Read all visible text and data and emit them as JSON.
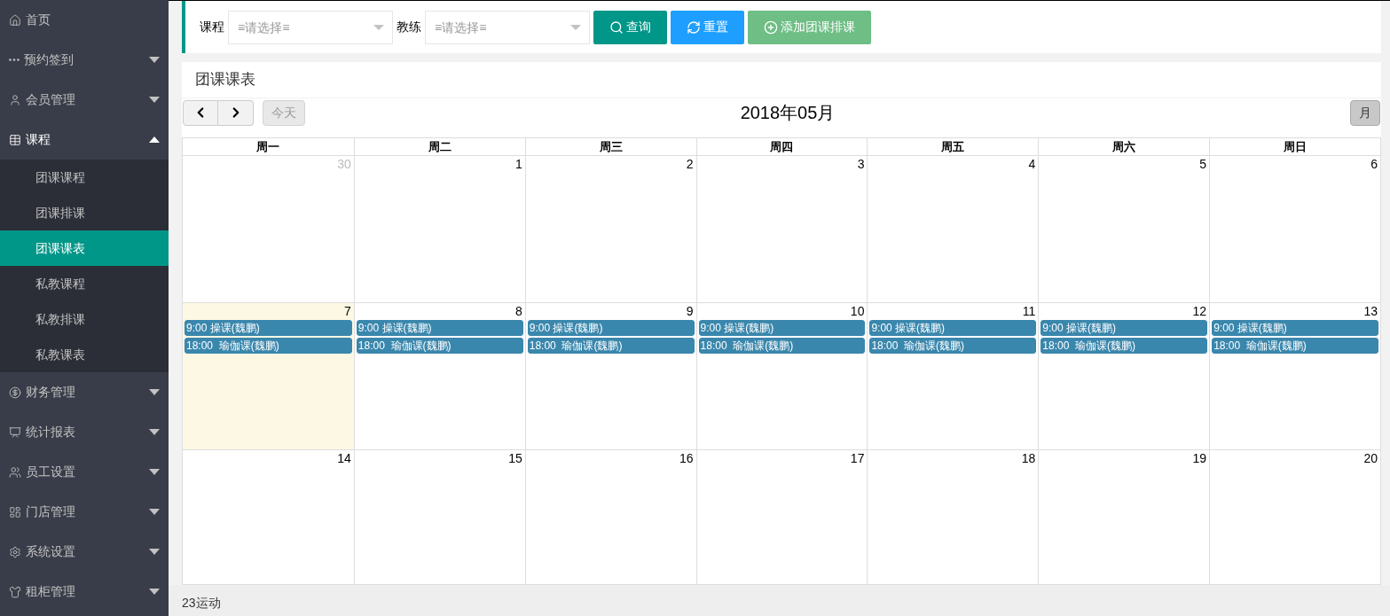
{
  "sidebar": {
    "items": [
      {
        "label": "首页",
        "kind": "link"
      },
      {
        "label": "预约签到",
        "kind": "menu",
        "expanded": false
      },
      {
        "label": "会员管理",
        "kind": "menu",
        "expanded": false
      },
      {
        "label": "课程",
        "kind": "menu",
        "expanded": true,
        "children": [
          {
            "label": "团课课程",
            "selected": false
          },
          {
            "label": "团课排课",
            "selected": false
          },
          {
            "label": "团课课表",
            "selected": true
          },
          {
            "label": "私教课程",
            "selected": false
          },
          {
            "label": "私教排课",
            "selected": false
          },
          {
            "label": "私教课表",
            "selected": false
          }
        ]
      },
      {
        "label": "财务管理",
        "kind": "menu",
        "expanded": false
      },
      {
        "label": "统计报表",
        "kind": "menu",
        "expanded": false
      },
      {
        "label": "员工设置",
        "kind": "menu",
        "expanded": false
      },
      {
        "label": "门店管理",
        "kind": "menu",
        "expanded": false
      },
      {
        "label": "系统设置",
        "kind": "menu",
        "expanded": false
      },
      {
        "label": "租柜管理",
        "kind": "menu",
        "expanded": false
      }
    ]
  },
  "filters": [
    {
      "label": "课程",
      "placeholder": "≡请选择≡"
    },
    {
      "label": "教练",
      "placeholder": "≡请选择≡"
    }
  ],
  "buttons": [
    {
      "label": "查询",
      "kind": "search"
    },
    {
      "label": "重置",
      "kind": "reset"
    },
    {
      "label": "添加团课排课",
      "kind": "add"
    }
  ],
  "panel": {
    "title": "团课课表"
  },
  "calendar": {
    "today_button": "今天",
    "title": "2018年05月",
    "view_button": "月",
    "weekdays": [
      "周一",
      "周二",
      "周三",
      "周四",
      "周五",
      "周六",
      "周日"
    ],
    "weeks": [
      {
        "days": [
          {
            "day": "30",
            "other_month": true,
            "today": false
          },
          {
            "day": "1",
            "other_month": false,
            "today": false
          },
          {
            "day": "2",
            "other_month": false,
            "today": false
          },
          {
            "day": "3",
            "other_month": false,
            "today": false
          },
          {
            "day": "4",
            "other_month": false,
            "today": false
          },
          {
            "day": "5",
            "other_month": false,
            "today": false
          },
          {
            "day": "6",
            "other_month": false,
            "today": false
          }
        ]
      },
      {
        "days": [
          {
            "day": "7",
            "other_month": false,
            "today": true,
            "events": [
              "9:00 操课(魏鹏)",
              "18:00  瑜伽课(魏鹏)"
            ]
          },
          {
            "day": "8",
            "other_month": false,
            "today": false,
            "events": [
              "9:00 操课(魏鹏)",
              "18:00  瑜伽课(魏鹏)"
            ]
          },
          {
            "day": "9",
            "other_month": false,
            "today": false,
            "events": [
              "9:00 操课(魏鹏)",
              "18:00  瑜伽课(魏鹏)"
            ]
          },
          {
            "day": "10",
            "other_month": false,
            "today": false,
            "events": [
              "9:00 操课(魏鹏)",
              "18:00  瑜伽课(魏鹏)"
            ]
          },
          {
            "day": "11",
            "other_month": false,
            "today": false,
            "events": [
              "9:00 操课(魏鹏)",
              "18:00  瑜伽课(魏鹏)"
            ]
          },
          {
            "day": "12",
            "other_month": false,
            "today": false,
            "events": [
              "9:00 操课(魏鹏)",
              "18:00  瑜伽课(魏鹏)"
            ]
          },
          {
            "day": "13",
            "other_month": false,
            "today": false,
            "events": [
              "9:00 操课(魏鹏)",
              "18:00  瑜伽课(魏鹏)"
            ]
          }
        ]
      },
      {
        "days": [
          {
            "day": "14",
            "other_month": false,
            "today": false
          },
          {
            "day": "15",
            "other_month": false,
            "today": false
          },
          {
            "day": "16",
            "other_month": false,
            "today": false
          },
          {
            "day": "17",
            "other_month": false,
            "today": false
          },
          {
            "day": "18",
            "other_month": false,
            "today": false
          },
          {
            "day": "19",
            "other_month": false,
            "today": false
          },
          {
            "day": "20",
            "other_month": false,
            "today": false
          }
        ]
      }
    ]
  },
  "footer": "23运动"
}
